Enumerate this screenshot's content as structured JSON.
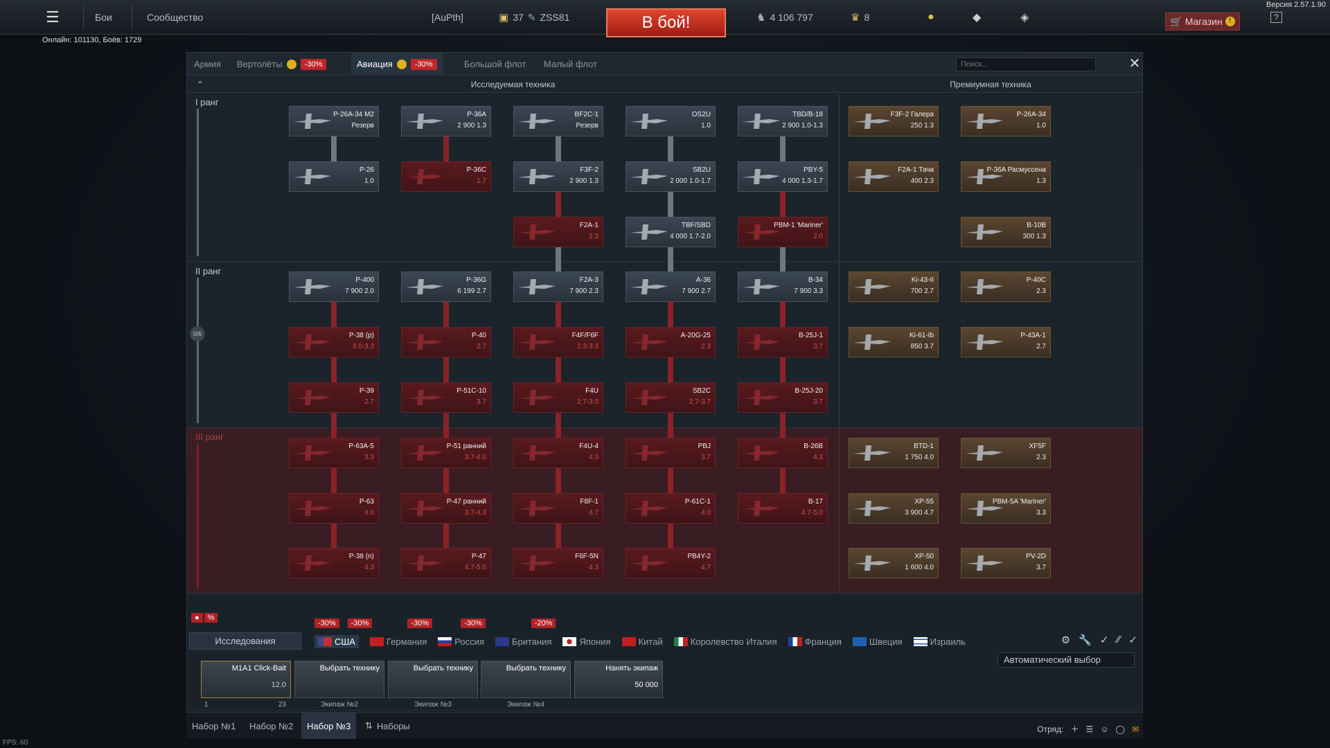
{
  "version": "Версия 2.57.1.90",
  "online": "Онлайн: 101130, Боёв: 1729",
  "topbar": {
    "battles": "Бои",
    "community": "Сообщество",
    "squadron": "[AuPth]",
    "level": "37",
    "nickname": "ZSS81",
    "battle_button": "В бой!",
    "silver": "4 106 797",
    "golden": "8",
    "shop": "Магазин"
  },
  "tabs": [
    {
      "label": "Армия"
    },
    {
      "label": "Вертолёты",
      "discount": "-30%"
    },
    {
      "label": "Авиация",
      "discount": "-30%"
    },
    {
      "label": "Большой флот"
    },
    {
      "label": "Малый флот"
    }
  ],
  "search_placeholder": "Поиск...",
  "headers": {
    "research": "Исследуемая техника",
    "premium": "Премиумная техника"
  },
  "ranks": {
    "r1": "I ранг",
    "r2": "II ранг",
    "r3": "III ранг",
    "progress": "0/6"
  },
  "cards": {
    "c1": {
      "name": "P-26A-34 M2",
      "val": "Резерв"
    },
    "c2": {
      "name": "P-36A",
      "val": "2 900 1.3"
    },
    "c3": {
      "name": "BF2C-1",
      "val": "Резерв"
    },
    "c4": {
      "name": "OS2U",
      "val": "1.0"
    },
    "c5": {
      "name": "TBD/B-18",
      "val": "2 900 1.0-1.3"
    },
    "c6": {
      "name": "P-26",
      "val": "1.0"
    },
    "c7": {
      "name": "P-36C",
      "val": "1.7"
    },
    "c8": {
      "name": "F3F-2",
      "val": "2 900 1.3"
    },
    "c9": {
      "name": "SB2U",
      "val": "2 000 1.0-1.7"
    },
    "c10": {
      "name": "PBY-5",
      "val": "4 000 1.3-1.7"
    },
    "c11": {
      "name": "F2A-1",
      "val": "2.3"
    },
    "c12": {
      "name": "TBF/SBD",
      "val": "4 000 1.7-2.0"
    },
    "c13": {
      "name": "PBM-1 'Mariner'",
      "val": "2.0"
    },
    "c14": {
      "name": "P-400",
      "val": "7 900 2.0"
    },
    "c15": {
      "name": "P-36G",
      "val": "6 199 2.7"
    },
    "c16": {
      "name": "F2A-3",
      "val": "7 900 2.3"
    },
    "c17": {
      "name": "A-36",
      "val": "7 900 2.7"
    },
    "c18": {
      "name": "B-34",
      "val": "7 900 3.3"
    },
    "c19": {
      "name": "P-38 (p)",
      "val": "3.0-3.3"
    },
    "c20": {
      "name": "P-40",
      "val": "2.7"
    },
    "c21": {
      "name": "F4F/F6F",
      "val": "2.3-3.3"
    },
    "c22": {
      "name": "A-20G-25",
      "val": "2.3"
    },
    "c23": {
      "name": "B-25J-1",
      "val": "3.7"
    },
    "c24": {
      "name": "P-39",
      "val": "2.7"
    },
    "c25": {
      "name": "P-51C-10",
      "val": "3.7"
    },
    "c26": {
      "name": "F4U",
      "val": "2.7-3.0"
    },
    "c27": {
      "name": "SB2C",
      "val": "2.7-3.7"
    },
    "c28": {
      "name": "B-25J-20",
      "val": "3.7"
    },
    "c29": {
      "name": "P-63A-5",
      "val": "3.3"
    },
    "c30": {
      "name": "P-51 ранний",
      "val": "3.7-4.0"
    },
    "c31": {
      "name": "F4U-4",
      "val": "4.3"
    },
    "c32": {
      "name": "PBJ",
      "val": "3.7"
    },
    "c33": {
      "name": "B-26B",
      "val": "4.3"
    },
    "c34": {
      "name": "P-63",
      "val": "4.0"
    },
    "c35": {
      "name": "P-47 ранний",
      "val": "3.7-4.3"
    },
    "c36": {
      "name": "F8F-1",
      "val": "4.7"
    },
    "c37": {
      "name": "P-61C-1",
      "val": "4.0"
    },
    "c38": {
      "name": "B-17",
      "val": "4.7-5.0"
    },
    "c39": {
      "name": "P-38 (n)",
      "val": "4.3"
    },
    "c40": {
      "name": "P-47",
      "val": "4.7-5.0"
    },
    "c41": {
      "name": "F6F-5N",
      "val": "4.3"
    },
    "c42": {
      "name": "PB4Y-2",
      "val": "4.7"
    }
  },
  "premium": {
    "p1": {
      "name": "F3F-2 Галера",
      "val": "250 1.3"
    },
    "p2": {
      "name": "P-26A-34",
      "val": "1.0"
    },
    "p3": {
      "name": "F2A-1 Тача",
      "val": "400 2.3"
    },
    "p4": {
      "name": "P-36A Расмуссена",
      "val": "1.3"
    },
    "p5": {
      "name": "B-10B",
      "val": "300 1.3"
    },
    "p6": {
      "name": "Ki-43-II",
      "val": "700 2.7"
    },
    "p7": {
      "name": "P-40C",
      "val": "2.3"
    },
    "p8": {
      "name": "Ki-61-Ib",
      "val": "850 3.7"
    },
    "p9": {
      "name": "P-43A-1",
      "val": "2.7"
    },
    "p10": {
      "name": "BTD-1",
      "val": "1 750 4.0"
    },
    "p11": {
      "name": "XF5F",
      "val": "2.3"
    },
    "p12": {
      "name": "XP-55",
      "val": "3 900 4.7"
    },
    "p13": {
      "name": "PBM-5A 'Mariner'",
      "val": "3.3"
    },
    "p14": {
      "name": "XP-50",
      "val": "1 600 4.0"
    },
    "p15": {
      "name": "PV-2D",
      "val": "3.7"
    }
  },
  "autoselect": "Автоматический выбор",
  "research_btn": "Исследования",
  "discounts": [
    "-30%",
    "-30%",
    "-30%",
    "-30%",
    "-20%"
  ],
  "nations": [
    "США",
    "Германия",
    "Россия",
    "Британия",
    "Япония",
    "Китай",
    "Королевство Италия",
    "Франция",
    "Швеция",
    "Израиль"
  ],
  "crew": {
    "s1": {
      "name": "M1A1 Click-Bait",
      "br": "12.0",
      "n": "1",
      "pts": "23"
    },
    "s2": {
      "name": "Выбрать технику",
      "sub": "Экипаж №2"
    },
    "s3": {
      "name": "Выбрать технику",
      "sub": "Экипаж №3"
    },
    "s4": {
      "name": "Выбрать технику",
      "sub": "Экипаж №4"
    },
    "s5": {
      "name": "Нанять экипаж",
      "cost": "50 000"
    }
  },
  "presets": [
    "Набор №1",
    "Набор №2",
    "Набор №3",
    "Наборы"
  ],
  "squad": "Отряд:",
  "fps": "FPS: 60"
}
